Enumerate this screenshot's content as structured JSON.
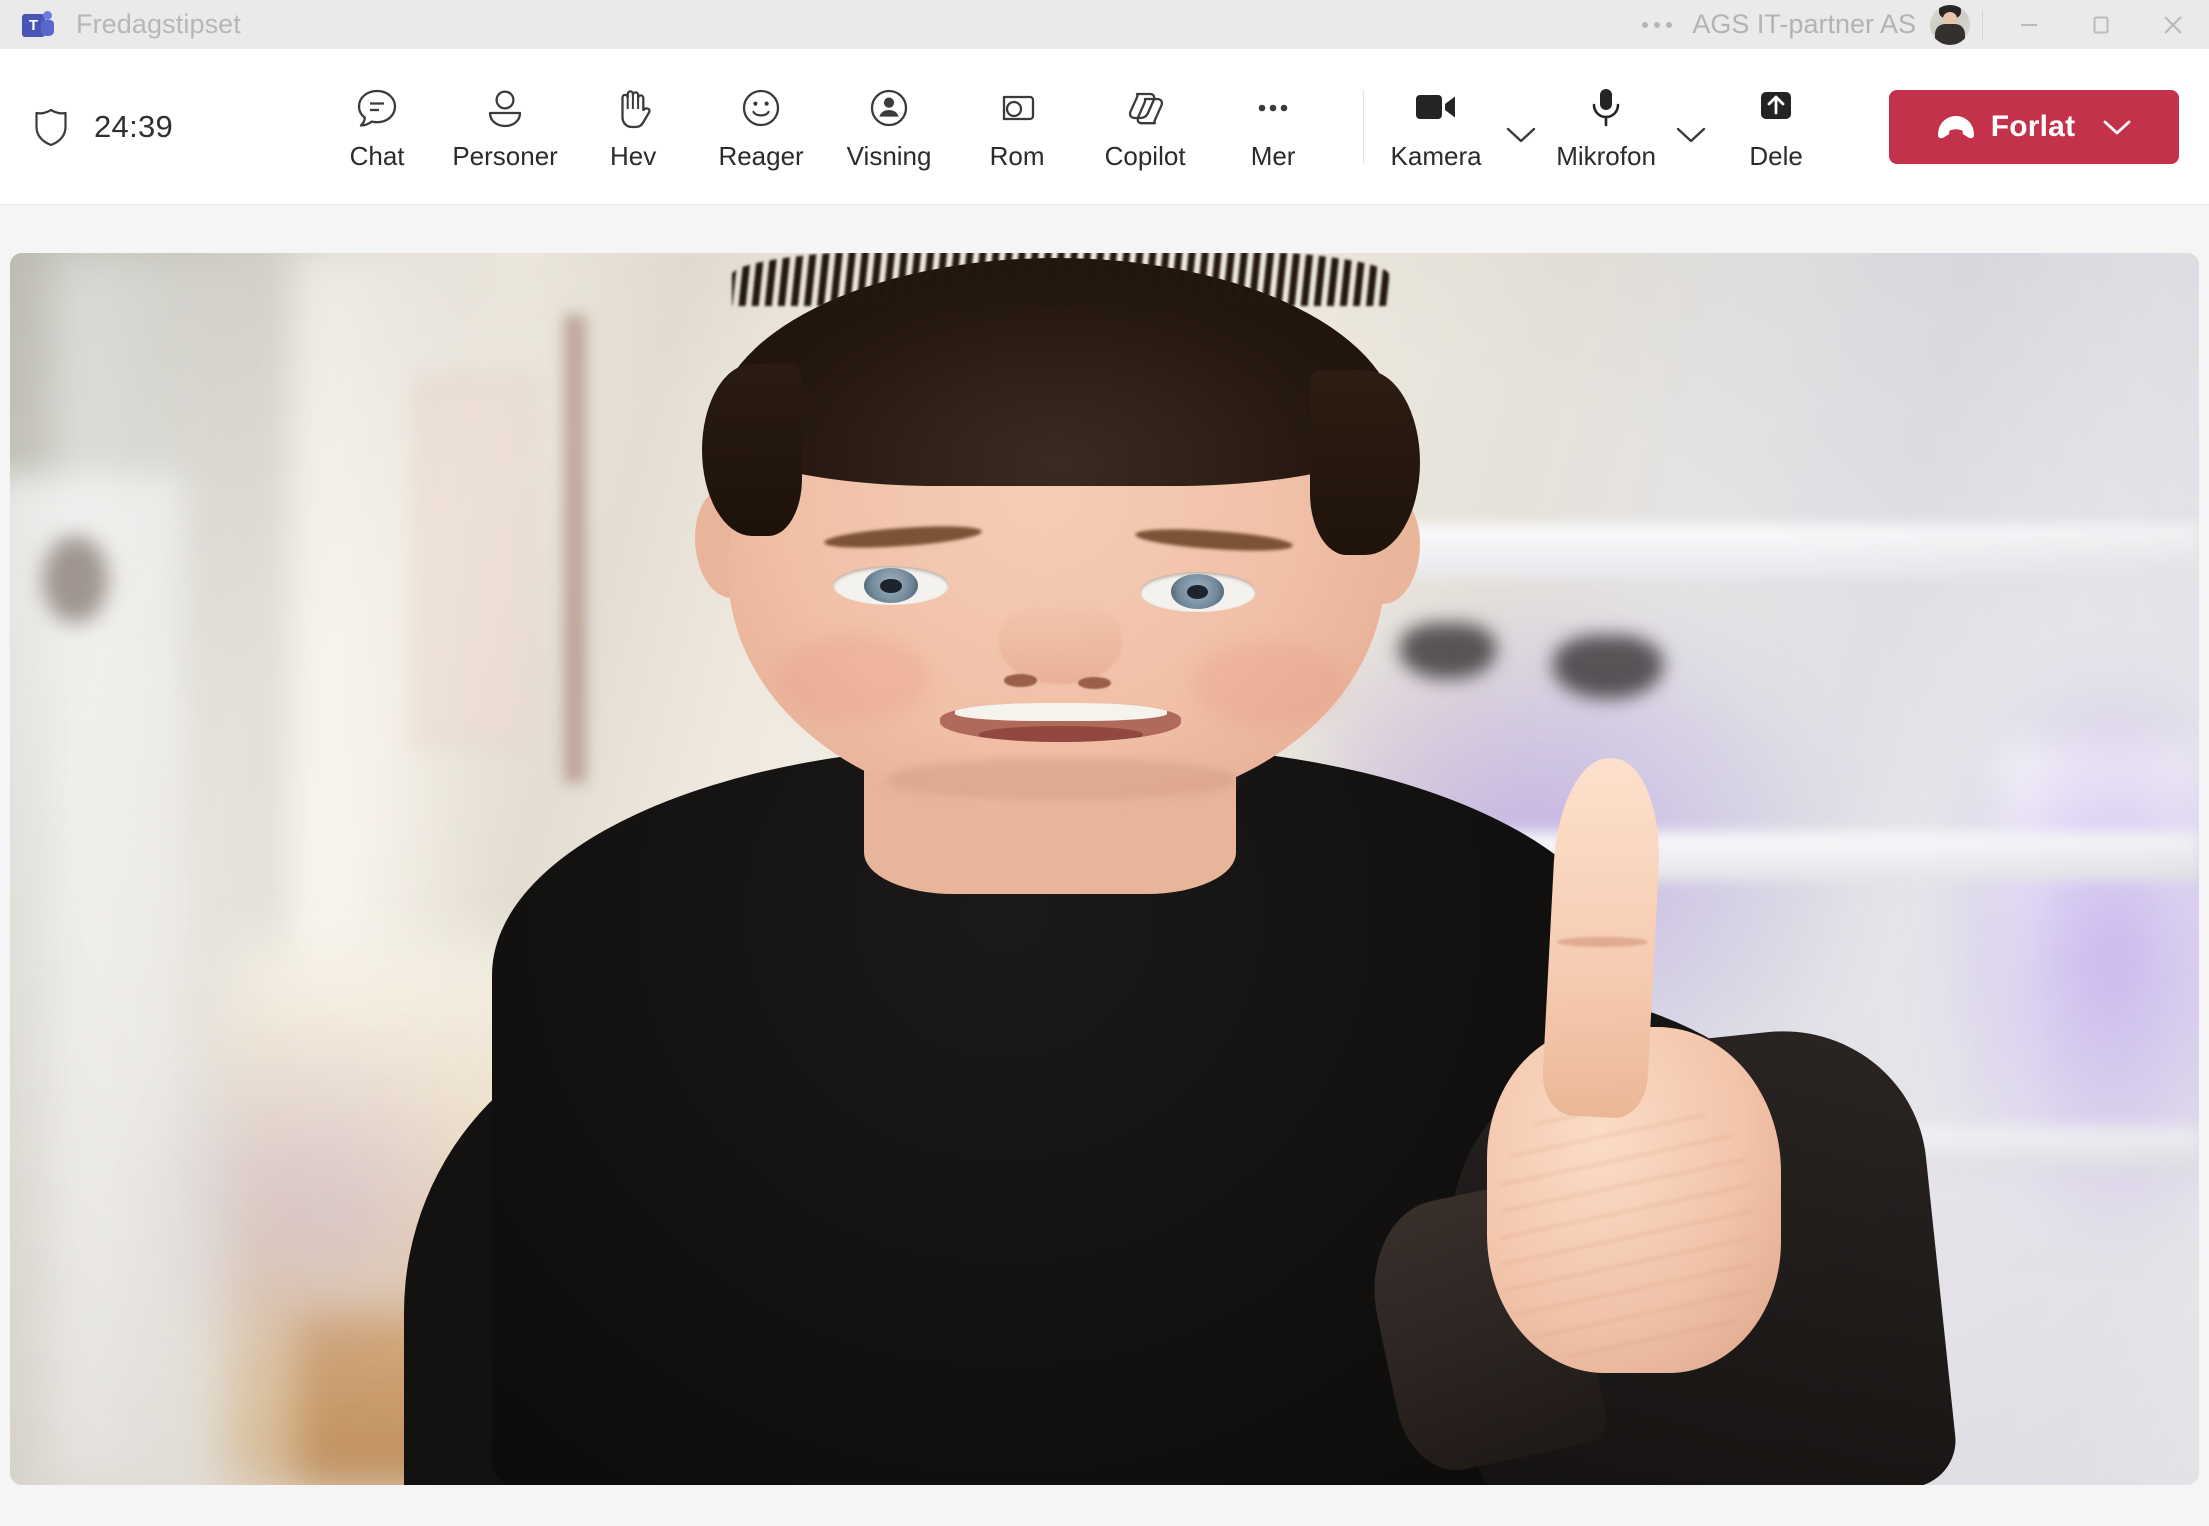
{
  "titlebar": {
    "app_logo_letter": "T",
    "logo_icon": "teams-logo-icon",
    "title": "Fredagstipset",
    "overflow_icon": "more-horizontal-icon",
    "org_name": "AGS IT-partner AS",
    "avatar_icon": "user-avatar",
    "window_controls": {
      "minimize": "minimize-icon",
      "maximize": "maximize-icon",
      "close": "close-icon"
    }
  },
  "toolbar": {
    "shield_icon": "shield-icon",
    "timer": "24:39",
    "items": [
      {
        "label": "Chat",
        "icon": "chat-bubble-icon"
      },
      {
        "label": "Personer",
        "icon": "people-icon"
      },
      {
        "label": "Hev",
        "icon": "raised-hand-icon"
      },
      {
        "label": "Reager",
        "icon": "smiley-face-icon"
      },
      {
        "label": "Visning",
        "icon": "view-person-icon"
      },
      {
        "label": "Rom",
        "icon": "room-icon"
      },
      {
        "label": "Copilot",
        "icon": "copilot-icon"
      },
      {
        "label": "Mer",
        "icon": "more-horizontal-icon"
      }
    ],
    "devices": [
      {
        "label": "Kamera",
        "icon": "camera-filled-icon",
        "state": "on",
        "has_chevron": true
      },
      {
        "label": "Mikrofon",
        "icon": "microphone-filled-icon",
        "state": "on",
        "has_chevron": true
      },
      {
        "label": "Dele",
        "icon": "share-screen-icon",
        "state": "off",
        "has_chevron": false
      }
    ],
    "leave_button": {
      "label": "Forlat",
      "icon": "hangup-phone-icon",
      "chevron_icon": "chevron-down-icon",
      "color": "#c4314b"
    }
  },
  "stage": {
    "video_tile": {
      "participant_description": "man in black sweater giving a thumbs up, blurred home interior background with shelves, game controllers and purple accent lighting",
      "background_blur": "on"
    }
  },
  "colors": {
    "titlebar_bg": "#eaeaea",
    "toolbar_bg": "#ffffff",
    "page_bg": "#f5f5f5",
    "text": "#2b2b2b",
    "muted_text": "#b3b3b3",
    "leave_red": "#c4314b",
    "teams_purple": "#4a55b5"
  }
}
